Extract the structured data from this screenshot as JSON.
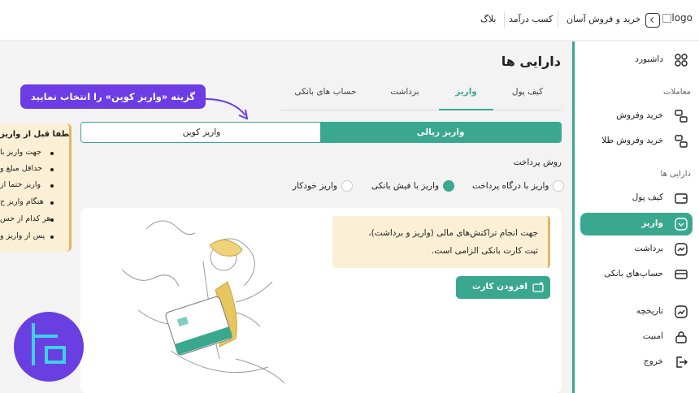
{
  "topbar": {
    "logo_text": "logo",
    "links": [
      "خرید و فروش آسان",
      "کسب درآمد",
      "بلاگ"
    ]
  },
  "sidebar": {
    "dashboard": "داشبورد",
    "section_trades": "معاملات",
    "buy_sell": "خرید وفروش",
    "buy_sell_gold": "خرید وفروش طلا",
    "section_assets": "دارایی ها",
    "wallet": "کیف پول",
    "deposit": "واریز",
    "withdraw": "برداشت",
    "bank_accounts": "حساب‌های بانکی",
    "history": "تاریخچه",
    "security": "امنیت",
    "logout": "خروج"
  },
  "main": {
    "title": "دارایی ها",
    "tabs": [
      "کیف پول",
      "واریز",
      "برداشت",
      "حساب های بانکی"
    ],
    "active_tab": "واریز",
    "subtabs": {
      "rial": "واریز ریالی",
      "coin": "واریز کوین"
    },
    "method_title": "روش پرداخت",
    "methods": [
      "واریز با درگاه پرداخت",
      "واریز با فیش بانکی",
      "واریز خودکار"
    ],
    "notice_line1": "جهت انجام تراکنش‌های مالی (واریز و برداشت)،",
    "notice_line2": "ثبت کارت بانکی الزامی است.",
    "add_card_button": "افزودن کارت"
  },
  "side_note": {
    "title": "لطفا قبل از واریز",
    "items": [
      "جهت واریز با",
      "حداقل مبلغ و",
      "واریز حتما از",
      "هنگام واریز ح",
      "هر کدام از حس",
      "پس از واریز و"
    ]
  },
  "callout": {
    "text": "گزینه «واریز کوین» را انتخاب نمایید"
  },
  "colors": {
    "accent": "#3aa88e",
    "callout": "#6c3ce4",
    "notice_bg": "#fbf0d6",
    "notice_border": "#e2b85a"
  }
}
